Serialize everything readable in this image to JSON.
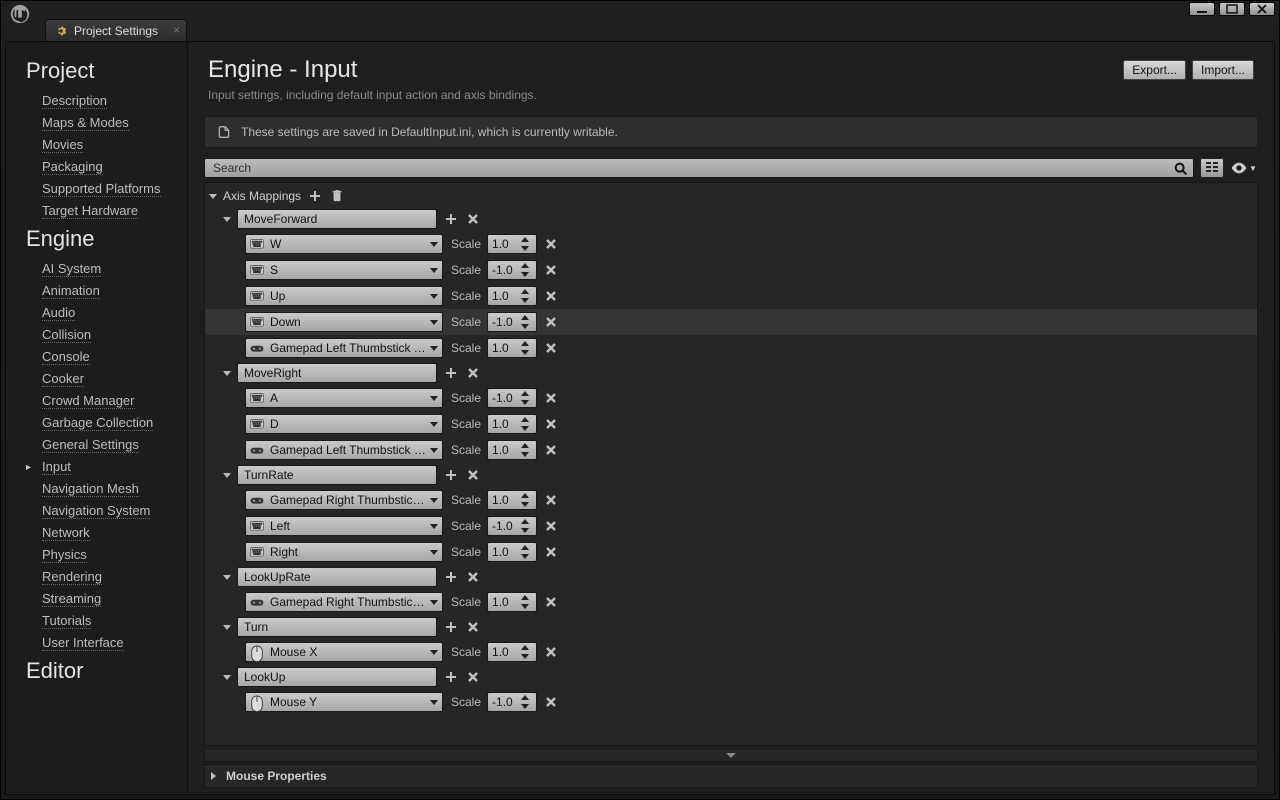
{
  "window": {
    "tab_title": "Project Settings"
  },
  "sidebar": {
    "sections": [
      {
        "title": "Project",
        "items": [
          "Description",
          "Maps & Modes",
          "Movies",
          "Packaging",
          "Supported Platforms",
          "Target Hardware"
        ]
      },
      {
        "title": "Engine",
        "items": [
          "AI System",
          "Animation",
          "Audio",
          "Collision",
          "Console",
          "Cooker",
          "Crowd Manager",
          "Garbage Collection",
          "General Settings",
          "Input",
          "Navigation Mesh",
          "Navigation System",
          "Network",
          "Physics",
          "Rendering",
          "Streaming",
          "Tutorials",
          "User Interface"
        ],
        "active": "Input"
      },
      {
        "title": "Editor",
        "items": []
      }
    ]
  },
  "header": {
    "title": "Engine - Input",
    "subtitle": "Input settings, including default input action and axis bindings.",
    "export_label": "Export...",
    "import_label": "Import..."
  },
  "infobar": {
    "text": "These settings are saved in DefaultInput.ini, which is currently writable."
  },
  "search": {
    "placeholder": "Search"
  },
  "section_title": "Axis Mappings",
  "scale_label": "Scale",
  "collapsed_section": "Mouse Properties",
  "mappings": [
    {
      "name": "MoveForward",
      "bindings": [
        {
          "key": "W",
          "icon": "keyboard",
          "scale": "1.0"
        },
        {
          "key": "S",
          "icon": "keyboard",
          "scale": "-1.0"
        },
        {
          "key": "Up",
          "icon": "keyboard",
          "scale": "1.0"
        },
        {
          "key": "Down",
          "icon": "keyboard",
          "scale": "-1.0",
          "highlight": true
        },
        {
          "key": "Gamepad Left Thumbstick Y-Axis",
          "icon": "gamepad",
          "scale": "1.0"
        }
      ]
    },
    {
      "name": "MoveRight",
      "bindings": [
        {
          "key": "A",
          "icon": "keyboard",
          "scale": "-1.0"
        },
        {
          "key": "D",
          "icon": "keyboard",
          "scale": "1.0"
        },
        {
          "key": "Gamepad Left Thumbstick X-Axis",
          "icon": "gamepad",
          "scale": "1.0"
        }
      ]
    },
    {
      "name": "TurnRate",
      "bindings": [
        {
          "key": "Gamepad Right Thumbstick X-Ax",
          "icon": "gamepad",
          "scale": "1.0"
        },
        {
          "key": "Left",
          "icon": "keyboard",
          "scale": "-1.0"
        },
        {
          "key": "Right",
          "icon": "keyboard",
          "scale": "1.0"
        }
      ]
    },
    {
      "name": "LookUpRate",
      "bindings": [
        {
          "key": "Gamepad Right Thumbstick Y-Ax",
          "icon": "gamepad",
          "scale": "1.0"
        }
      ]
    },
    {
      "name": "Turn",
      "bindings": [
        {
          "key": "Mouse X",
          "icon": "mouse",
          "scale": "1.0"
        }
      ]
    },
    {
      "name": "LookUp",
      "bindings": [
        {
          "key": "Mouse Y",
          "icon": "mouse",
          "scale": "-1.0"
        }
      ]
    }
  ]
}
